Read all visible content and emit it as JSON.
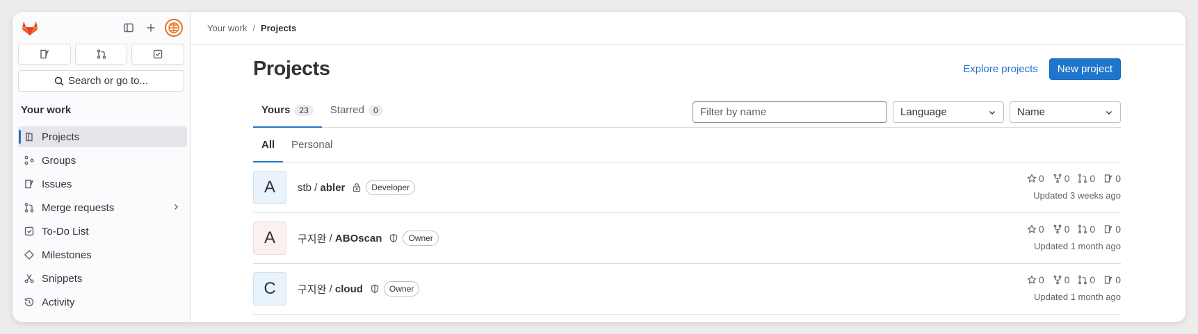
{
  "sidebar": {
    "search_label": "Search or go to...",
    "heading": "Your work",
    "items": [
      {
        "label": "Projects",
        "icon": "project-icon",
        "active": true
      },
      {
        "label": "Groups",
        "icon": "group-icon"
      },
      {
        "label": "Issues",
        "icon": "issues-icon"
      },
      {
        "label": "Merge requests",
        "icon": "merge-request-icon",
        "has_chevron": true
      },
      {
        "label": "To-Do List",
        "icon": "todo-icon"
      },
      {
        "label": "Milestones",
        "icon": "milestone-icon"
      },
      {
        "label": "Snippets",
        "icon": "snippet-icon"
      },
      {
        "label": "Activity",
        "icon": "history-icon"
      }
    ]
  },
  "breadcrumb": {
    "parent": "Your work",
    "separator": "/",
    "current": "Projects"
  },
  "page": {
    "title": "Projects",
    "explore_label": "Explore projects",
    "new_project_label": "New project"
  },
  "tabs": [
    {
      "label": "Yours",
      "count": "23"
    },
    {
      "label": "Starred",
      "count": "0"
    }
  ],
  "filters": {
    "filter_placeholder": "Filter by name",
    "language": "Language",
    "sort": "Name"
  },
  "subtabs": [
    "All",
    "Personal"
  ],
  "projects": [
    {
      "letter": "A",
      "namespace": "stb",
      "sep": " / ",
      "name": "abler",
      "visibility": "lock-icon",
      "role": "Developer",
      "stars": "0",
      "forks": "0",
      "mrs": "0",
      "issues": "0",
      "updated": "Updated 3 weeks ago",
      "avatar_color": "#e9f3fc"
    },
    {
      "letter": "A",
      "namespace": "구지완",
      "sep": " / ",
      "name": "ABOscan",
      "visibility": "shield-icon",
      "role": "Owner",
      "stars": "0",
      "forks": "0",
      "mrs": "0",
      "issues": "0",
      "updated": "Updated 1 month ago",
      "avatar_color": "#fcf1ef"
    },
    {
      "letter": "C",
      "namespace": "구지완",
      "sep": " / ",
      "name": "cloud",
      "visibility": "shield-icon",
      "role": "Owner",
      "stars": "0",
      "forks": "0",
      "mrs": "0",
      "issues": "0",
      "updated": "Updated 1 month ago",
      "avatar_color": "#e9f3fc"
    }
  ],
  "colors": {
    "accent": "#1f75cb",
    "logo_orange": "#e24329"
  }
}
